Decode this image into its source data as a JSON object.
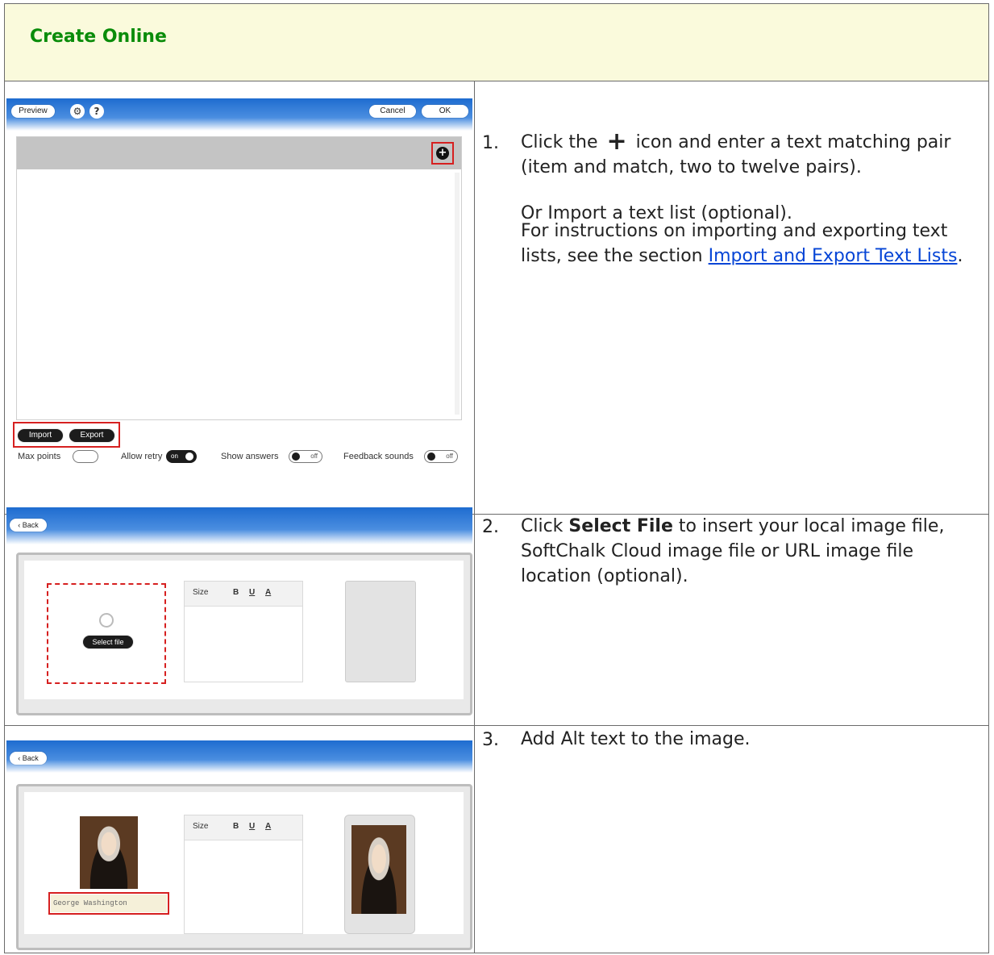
{
  "title": "Create Online",
  "steps": [
    {
      "number": "1.",
      "text_before_icon": "Click the",
      "icon": "plus-icon",
      "text_after_icon": "icon and enter a text matching pair (item and match, two to twelve pairs).",
      "optional_line": "Or Import a text list (optional).",
      "instructions_line": "For instructions on importing and exporting text lists, see the section",
      "link_text": "Import and Export Text Lists",
      "after_link": "."
    },
    {
      "number": "2.",
      "text_before": "Click",
      "bold": "Select File",
      "text_after": "to insert your local image file, SoftChalk Cloud image file or URL image file location (optional)."
    },
    {
      "number": "3.",
      "text": "Add Alt text to the image."
    }
  ],
  "shot1": {
    "preview": "Preview",
    "cancel": "Cancel",
    "ok": "OK",
    "help": "?",
    "gear": "⚙",
    "import": "Import",
    "export": "Export",
    "max_points": "Max points",
    "allow_retry": "Allow retry",
    "allow_retry_state": "on",
    "show_answers": "Show answers",
    "show_answers_state": "off",
    "feedback_sounds": "Feedback sounds",
    "feedback_sounds_state": "off"
  },
  "shot2": {
    "back": "Back",
    "select_file": "Select file",
    "size": "Size",
    "bold": "B",
    "underline": "U",
    "font_color": "A"
  },
  "shot3": {
    "back": "Back",
    "alt_text": "George Washington",
    "size": "Size",
    "bold": "B",
    "underline": "U",
    "font_color": "A"
  }
}
